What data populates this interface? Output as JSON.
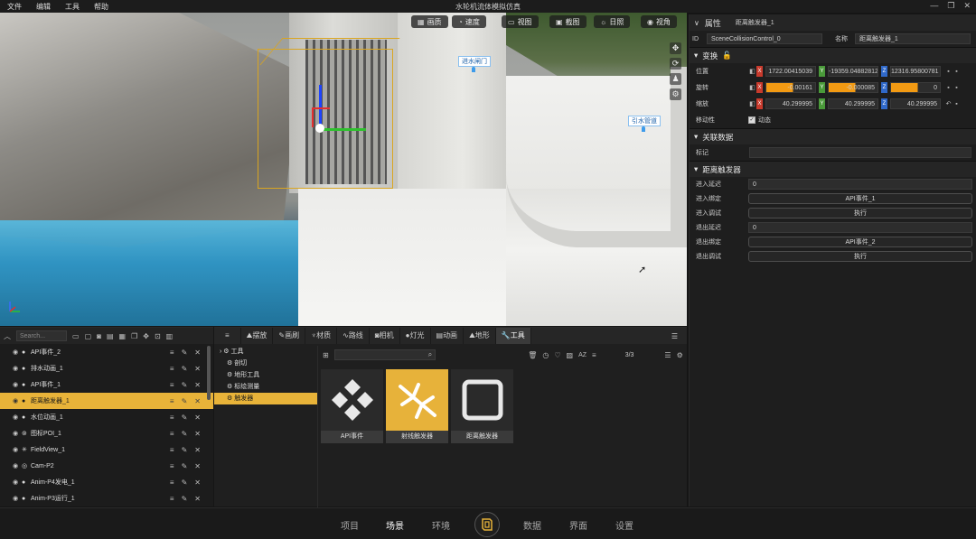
{
  "app": {
    "title": "水轮机流体模拟仿真",
    "menu": [
      "文件",
      "编辑",
      "工具",
      "帮助"
    ]
  },
  "viewport": {
    "toolbar": [
      {
        "label": "画质",
        "icon": "grid-icon"
      },
      {
        "label": "速度",
        "icon": "speed-icon"
      },
      {
        "label": "视图",
        "icon": "view-icon"
      },
      {
        "label": "截图",
        "icon": "screenshot-icon"
      },
      {
        "label": "日照",
        "icon": "sun-icon"
      },
      {
        "label": "视角",
        "icon": "eye-icon"
      }
    ],
    "tags": [
      "进水闸门",
      "引水管道"
    ]
  },
  "properties": {
    "header": "属性",
    "header_name": "距离触发器_1",
    "id_label": "ID",
    "id_value": "SceneCollisionControl_0",
    "name_label": "名称",
    "name_value": "距离触发器_1",
    "transform": {
      "title": "变换",
      "position_label": "位置",
      "position": {
        "x": "1722.00415039",
        "y": "-19359.04882812",
        "z": "12316.95800781"
      },
      "rotation_label": "旋转",
      "rotation": {
        "x": "-0.00161",
        "y": "-0.000085",
        "z": "0"
      },
      "scale_label": "缩放",
      "scale": {
        "x": "40.299995",
        "y": "40.299995",
        "z": "40.299995"
      },
      "mobility_label": "移动性",
      "mobility_value": "动态"
    },
    "assoc": {
      "title": "关联数据",
      "tag_label": "标记",
      "tag_value": ""
    },
    "trigger": {
      "title": "距离触发器",
      "enter_delay_label": "进入延迟",
      "enter_delay": "0",
      "enter_bind_label": "进入绑定",
      "enter_bind": "API事件_1",
      "enter_debug_label": "进入调试",
      "enter_debug": "执行",
      "exit_delay_label": "退出延迟",
      "exit_delay": "0",
      "exit_bind_label": "退出绑定",
      "exit_bind": "API事件_2",
      "exit_debug_label": "退出调试",
      "exit_debug": "执行"
    }
  },
  "outliner": {
    "search_placeholder": "Search...",
    "items": [
      {
        "name": "API事件_2",
        "selected": false
      },
      {
        "name": "排水动画_1",
        "selected": false
      },
      {
        "name": "API事件_1",
        "selected": false
      },
      {
        "name": "距离触发器_1",
        "selected": true
      },
      {
        "name": "水位动画_1",
        "selected": false
      },
      {
        "name": "图标POI_1",
        "selected": false
      },
      {
        "name": "FieldView_1",
        "selected": false
      },
      {
        "name": "Cam-P2",
        "selected": false
      },
      {
        "name": "Anim-P4发电_1",
        "selected": false
      },
      {
        "name": "Anim-P3运行_1",
        "selected": false
      }
    ]
  },
  "assets": {
    "tabs": [
      "摆放",
      "画刷",
      "材质",
      "路线",
      "相机",
      "灯光",
      "动画",
      "地形",
      "工具"
    ],
    "active_tab": "工具",
    "tree": [
      "工具",
      "剖切",
      "地形工具",
      "标绘测量",
      "触发器"
    ],
    "count": "3/3",
    "items": [
      "API事件",
      "射线触发器",
      "距离触发器"
    ]
  },
  "nav": {
    "items": [
      "项目",
      "场景",
      "环境",
      "数据",
      "界面",
      "设置"
    ],
    "active": "场景"
  },
  "colors": {
    "accent": "#e8b339",
    "bg": "#1e1e1e"
  }
}
